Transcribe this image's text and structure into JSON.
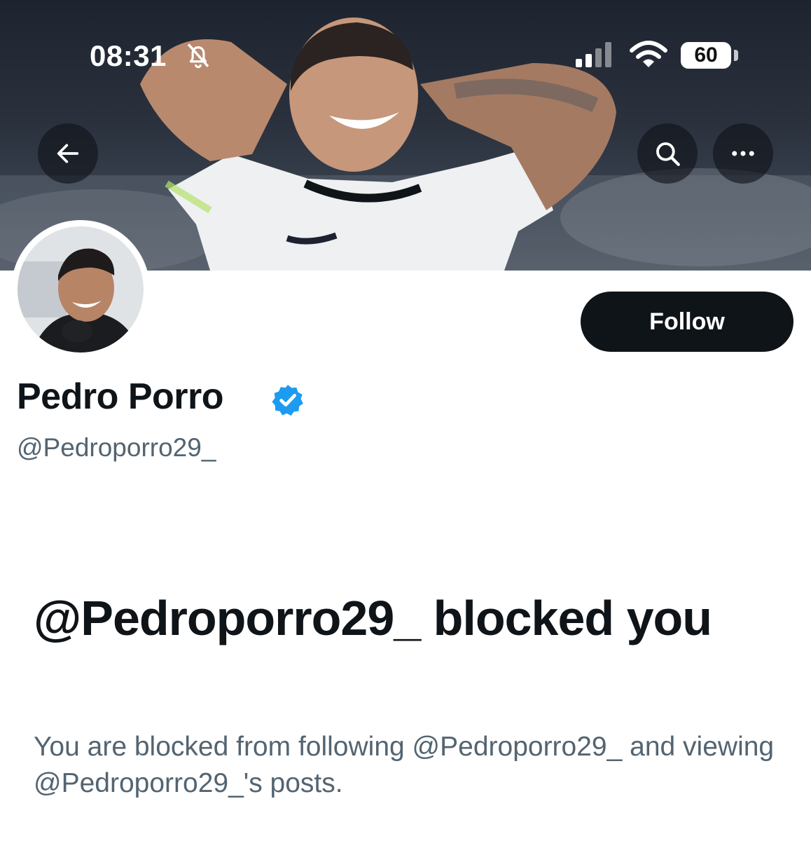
{
  "status_bar": {
    "time": "08:31",
    "battery": "60",
    "battery_level": 0.6,
    "icons": [
      "bell-slash-icon",
      "cellular-signal-icon",
      "wifi-icon",
      "battery-icon"
    ]
  },
  "nav": {
    "icons": [
      "arrow-left-icon",
      "search-icon",
      "more-horizontal-icon"
    ]
  },
  "profile": {
    "name": "Pedro Porro",
    "handle": "@Pedroporro29_",
    "verified": true,
    "follow_label": "Follow"
  },
  "blocked": {
    "title": "@Pedroporro29_ blocked you",
    "description": "You are blocked from following @Pedroporro29_ and viewing @Pedroporro29_'s posts."
  },
  "colors": {
    "primary_text": "#0f1419",
    "secondary_text": "#536471",
    "verified_blue": "#1d9bf0",
    "button_dark": "#0f1419"
  }
}
